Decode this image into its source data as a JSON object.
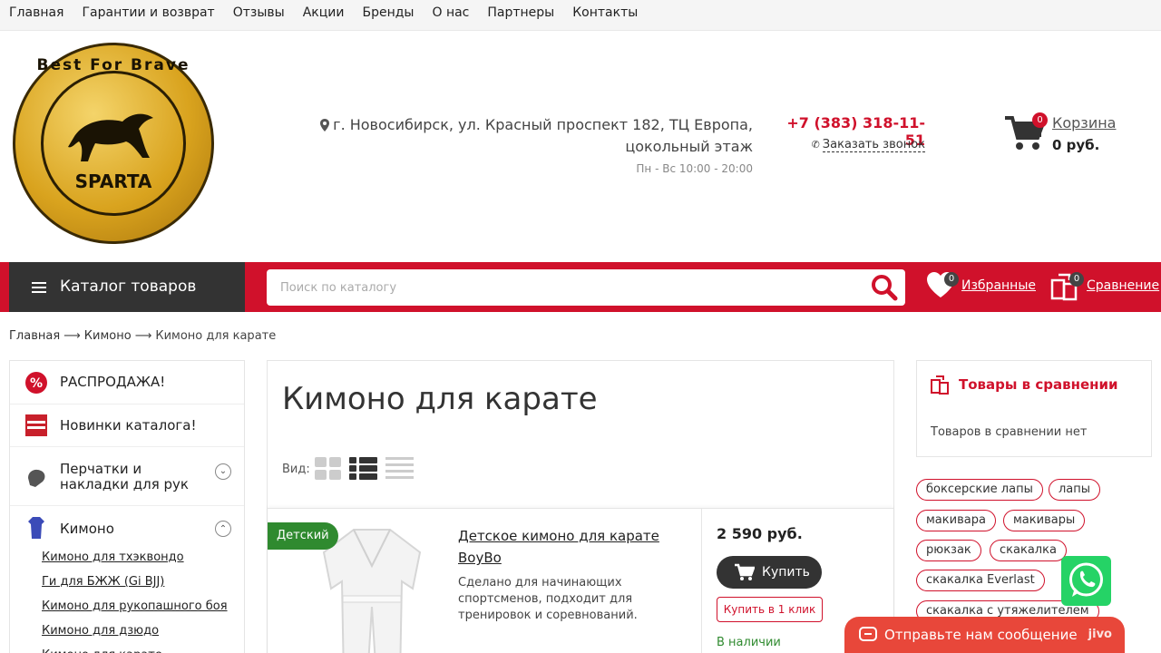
{
  "topnav": [
    "Главная",
    "Гарантии и возврат",
    "Отзывы",
    "Акции",
    "Бренды",
    "О нас",
    "Партнеры",
    "Контакты"
  ],
  "logo": {
    "ring_text": "Best For Brave",
    "brand": "SPARTA"
  },
  "header": {
    "address": "г. Новосибирск, ул. Красный проспект 182, ТЦ Европа, цокольный этаж",
    "hours": "Пн - Вс 10:00 - 20:00",
    "phone": "+7 (383) 318-11-51",
    "callback": "Заказать звонок",
    "cart_label": "Корзина",
    "cart_sum": "0 руб.",
    "cart_count": "0"
  },
  "bar": {
    "catalog": "Каталог товаров",
    "search_placeholder": "Поиск по каталогу",
    "favorites": "Избранные",
    "favorites_count": "0",
    "compare": "Сравнение",
    "compare_count": "0"
  },
  "breadcrumb": {
    "home": "Главная",
    "parent": "Кимоно",
    "current": "Кимоно для карате"
  },
  "sidebar": {
    "items": [
      {
        "label": "РАСПРОДАЖА!",
        "icon": "sale-icon"
      },
      {
        "label": "Новинки каталога!",
        "icon": "new-icon"
      },
      {
        "label": "Перчатки и накладки для рук",
        "icon": "glove-icon"
      },
      {
        "label": "Кимоно",
        "icon": "kimono-icon"
      }
    ],
    "sub": [
      "Кимоно для тхэквондо",
      "Ги для БЖЖ (Gi BJJ)",
      "Кимоно для рукопашного боя",
      "Кимоно для дзюдо",
      "Кимоно для карате"
    ]
  },
  "main": {
    "title": "Кимоно для карате",
    "view_label": "Вид:",
    "product": {
      "badge": "Детский",
      "title": "Детское кимоно для карате BoyBo",
      "desc": "Сделано для начинающих спортсменов, подходит для тренировок и соревнований.",
      "price": "2 590 руб.",
      "buy": "Купить",
      "oneclick": "Купить в 1 клик",
      "stock": "В наличии"
    }
  },
  "compare_box": {
    "title": "Товары в сравнении",
    "empty": "Товаров в сравнении нет"
  },
  "tags": [
    "боксерские лапы",
    "лапы",
    "макивара",
    "макивары",
    "рюкзак",
    "скакалка",
    "скакалка Everlast",
    "скакалка с утяжелителем"
  ],
  "chat": {
    "text": "Отправьте нам сообщение",
    "brand": "jivo"
  },
  "colors": {
    "accent": "#d0112b",
    "dark": "#333333",
    "green": "#2f8a2f"
  }
}
